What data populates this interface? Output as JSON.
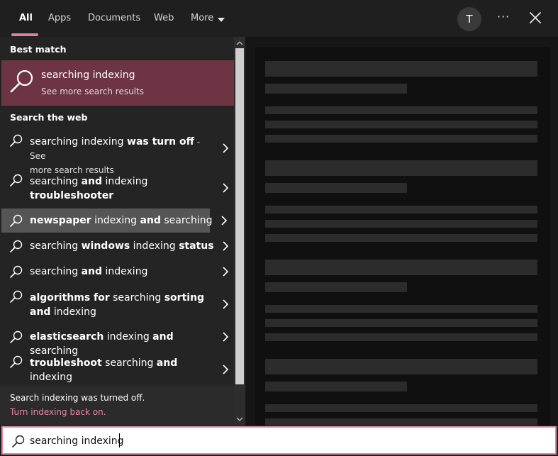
{
  "tabs": [
    {
      "label": "All"
    },
    {
      "label": "Apps"
    },
    {
      "label": "Documents"
    },
    {
      "label": "Web"
    },
    {
      "label": "More"
    }
  ],
  "account": {
    "initial": "T"
  },
  "toolbar": {
    "ellipsis": "···"
  },
  "best_match": {
    "section_label": "Best match",
    "title": "searching indexing",
    "subtitle": "See more search results",
    "icon": "search-icon"
  },
  "web": {
    "section_label": "Search the web",
    "items": [
      {
        "p1": "searching indexing ",
        "b1": "was turn off",
        "p2": " - See",
        "sub": "more search results"
      },
      {
        "p1": "searching ",
        "b1": "and",
        "p2": " indexing",
        "b2": "troubleshooter"
      },
      {
        "b1": "newspaper",
        "p1": " indexing ",
        "b2": "and",
        "p2": " searching"
      },
      {
        "p1": "searching ",
        "b1": "windows",
        "p2": " indexing ",
        "b2": "status"
      },
      {
        "p1": "searching ",
        "b1": "and",
        "p2": " indexing"
      },
      {
        "b1": "algorithms for",
        "p1": " searching ",
        "b2": "sorting",
        "b3": "and",
        "p3": " indexing"
      },
      {
        "b1": "elasticsearch",
        "p1": " indexing ",
        "b2": "and",
        "p2": " searching"
      },
      {
        "b1": "troubleshoot",
        "p1": " searching ",
        "b2": "and",
        "p2": "indexing"
      }
    ]
  },
  "status": {
    "message": "Search indexing was turned off.",
    "link": "Turn indexing back on."
  },
  "search": {
    "value": "searching indexing"
  },
  "colors": {
    "accent": "#e0809e",
    "best_match_bg": "#6d3443",
    "link": "#e889a6"
  }
}
